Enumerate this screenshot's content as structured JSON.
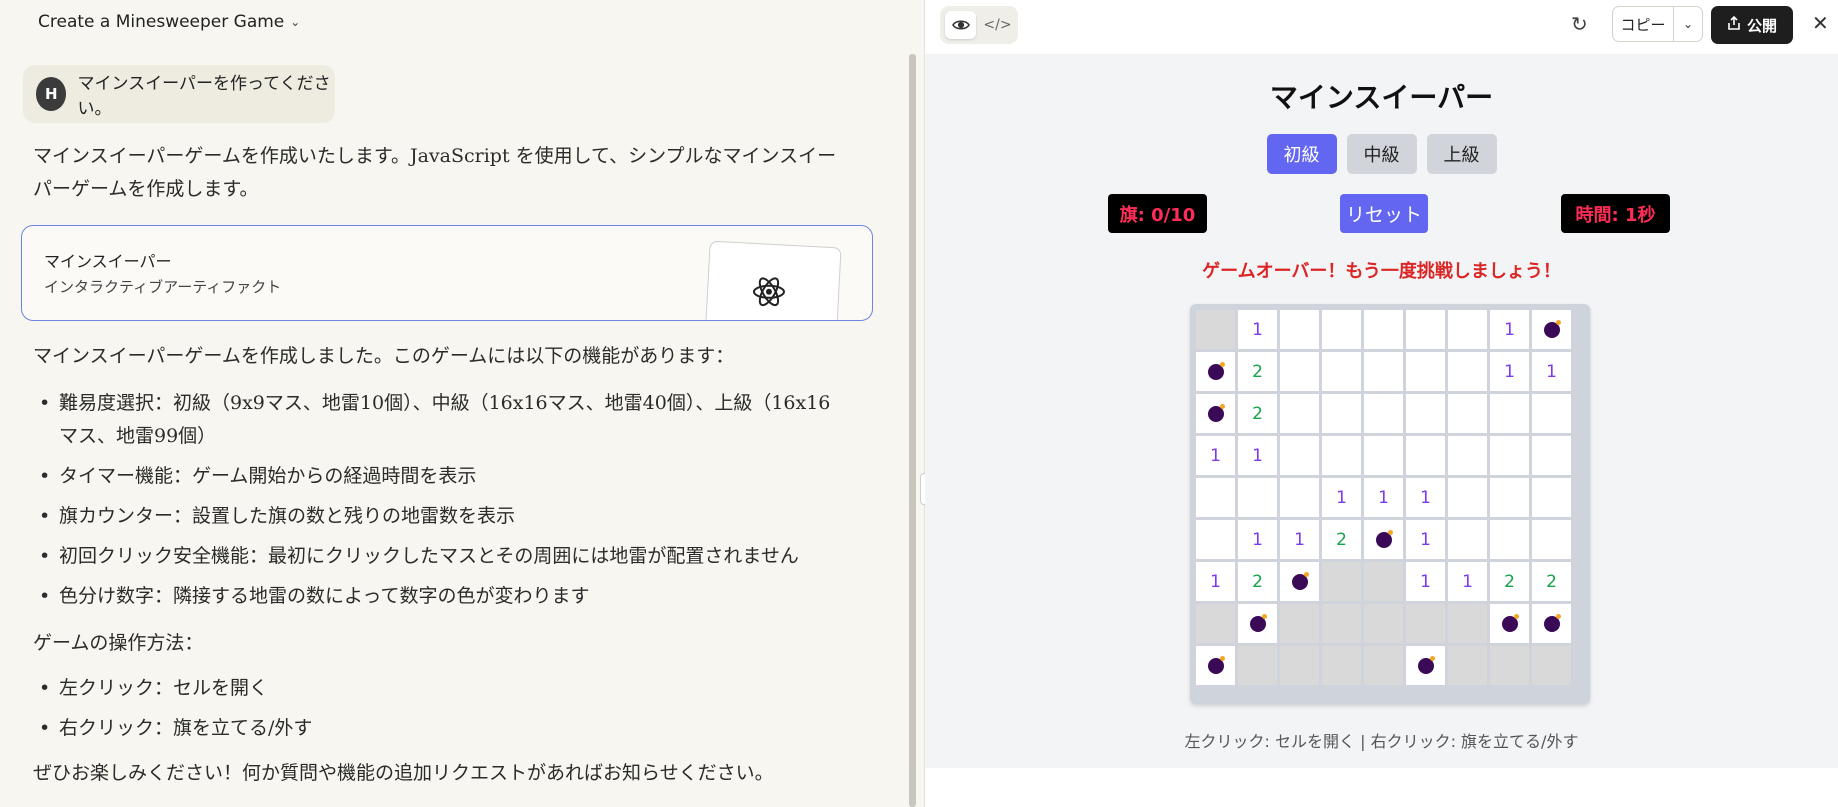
{
  "chat": {
    "title": "Create a Minesweeper Game",
    "user_initial": "H",
    "user_message": "マインスイーパーを作ってください。",
    "intro": "マインスイーパーゲームを作成いたします。JavaScript を使用して、シンプルなマインスイーパーゲームを作成します。",
    "artifact": {
      "title": "マインスイーパー",
      "subtitle": "インタラクティブアーティファクト",
      "icon": "atom-icon"
    },
    "features_heading": "マインスイーパーゲームを作成しました。このゲームには以下の機能があります：",
    "features": [
      "難易度選択：初級（9x9マス、地雷10個）、中級（16x16マス、地雷40個）、上級（16x16マス、地雷99個）",
      "タイマー機能：ゲーム開始からの経過時間を表示",
      "旗カウンター：設置した旗の数と残りの地雷数を表示",
      "初回クリック安全機能：最初にクリックしたマスとその周囲には地雷が配置されません",
      "色分け数字：隣接する地雷の数によって数字の色が変わります"
    ],
    "ops_heading": "ゲームの操作方法：",
    "ops": [
      "左クリック：セルを開く",
      "右クリック：旗を立てる/外す"
    ],
    "closing": "ぜひお楽しみください！何か質問や機能の追加リクエストがあればお知らせください。"
  },
  "toolbar": {
    "copy_label": "コピー",
    "publish_label": "公開"
  },
  "game": {
    "title": "マインスイーパー",
    "difficulties": [
      "初級",
      "中級",
      "上級"
    ],
    "selected_difficulty": "初級",
    "flags": "旗: 0/10",
    "reset_label": "リセット",
    "timer": "時間: 1秒",
    "message": "ゲームオーバー！もう一度挑戦しましょう！",
    "instructions": "左クリック: セルを開く | 右クリック: 旗を立てる/外す",
    "board": [
      [
        "h",
        "1",
        "o",
        "o",
        "o",
        "o",
        "o",
        "1",
        "b"
      ],
      [
        "b",
        "2",
        "o",
        "o",
        "o",
        "o",
        "o",
        "1",
        "1"
      ],
      [
        "b",
        "2",
        "o",
        "o",
        "o",
        "o",
        "o",
        "o",
        "o"
      ],
      [
        "1",
        "1",
        "o",
        "o",
        "o",
        "o",
        "o",
        "o",
        "o"
      ],
      [
        "o",
        "o",
        "o",
        "1",
        "1",
        "1",
        "o",
        "o",
        "o"
      ],
      [
        "o",
        "1",
        "1",
        "2",
        "b",
        "1",
        "o",
        "o",
        "o"
      ],
      [
        "1",
        "2",
        "b",
        "h",
        "h",
        "1",
        "1",
        "2",
        "2"
      ],
      [
        "h",
        "b",
        "h",
        "h",
        "h",
        "h",
        "h",
        "b",
        "b"
      ],
      [
        "b",
        "h",
        "h",
        "h",
        "h",
        "b",
        "h",
        "h",
        "h"
      ]
    ]
  }
}
